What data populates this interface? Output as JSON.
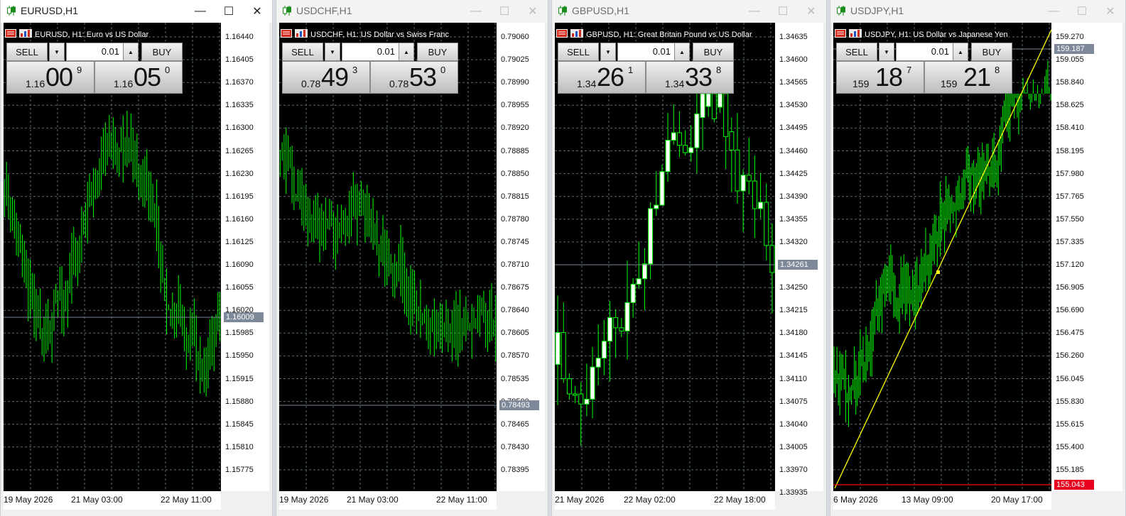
{
  "windows": [
    {
      "id": "eurusd",
      "title": "EURUSD,H1",
      "chart_label": "EURUSD, H1:  Euro vs US Dollar",
      "sell_label": "SELL",
      "buy_label": "BUY",
      "lot": "0.01",
      "sell_prefix": "1.16",
      "sell_big": "00",
      "sell_sup": "9",
      "buy_prefix": "1.16",
      "buy_big": "05",
      "buy_sup": "0",
      "current_price": "1.16009",
      "x_labels": [
        "19 May 2026",
        "21 May 03:00",
        "22 May 11:00"
      ],
      "y_labels": [
        "1.16440",
        "1.16405",
        "1.16370",
        "1.16335",
        "1.16300",
        "1.16265",
        "1.16230",
        "1.16195",
        "1.16160",
        "1.16125",
        "1.16090",
        "1.16055",
        "1.16020",
        "1.15985",
        "1.15950",
        "1.15915",
        "1.15880",
        "1.15845",
        "1.15810",
        "1.15775"
      ]
    },
    {
      "id": "usdchf",
      "title": "USDCHF,H1",
      "chart_label": "USDCHF, H1:  US Dollar vs Swiss Franc",
      "sell_label": "SELL",
      "buy_label": "BUY",
      "lot": "0.01",
      "sell_prefix": "0.78",
      "sell_big": "49",
      "sell_sup": "3",
      "buy_prefix": "0.78",
      "buy_big": "53",
      "buy_sup": "0",
      "current_price": "0.78493",
      "x_labels": [
        "19 May 2026",
        "21 May 03:00",
        "22 May 11:00"
      ],
      "y_labels": [
        "0.79060",
        "0.79025",
        "0.78990",
        "0.78955",
        "0.78920",
        "0.78885",
        "0.78850",
        "0.78815",
        "0.78780",
        "0.78745",
        "0.78710",
        "0.78675",
        "0.78640",
        "0.78605",
        "0.78570",
        "0.78535",
        "0.78500",
        "0.78465",
        "0.78430",
        "0.78395"
      ]
    },
    {
      "id": "gbpusd",
      "title": "GBPUSD,H1",
      "chart_label": "GBPUSD, H1:  Great Britain Pound vs US Dollar",
      "sell_label": "SELL",
      "buy_label": "BUY",
      "lot": "0.01",
      "sell_prefix": "1.34",
      "sell_big": "26",
      "sell_sup": "1",
      "buy_prefix": "1.34",
      "buy_big": "33",
      "buy_sup": "8",
      "current_price": "1.34261",
      "x_labels": [
        "21 May 2026",
        "22 May 02:00",
        "22 May 18:00"
      ],
      "y_labels": [
        "1.34635",
        "1.34600",
        "1.34565",
        "1.34530",
        "1.34495",
        "1.34460",
        "1.34425",
        "1.34390",
        "1.34355",
        "1.34320",
        "1.34285",
        "1.34250",
        "1.34215",
        "1.34180",
        "1.34145",
        "1.34110",
        "1.34075",
        "1.34040",
        "1.34005",
        "1.33970",
        "1.33935"
      ]
    },
    {
      "id": "usdjpy",
      "title": "USDJPY,H1",
      "chart_label": "USDJPY, H1:  US Dollar vs Japanese Yen",
      "sell_label": "SELL",
      "buy_label": "BUY",
      "lot": "0.01",
      "sell_prefix": "159",
      "sell_big": "18",
      "sell_sup": "7",
      "buy_prefix": "159",
      "buy_big": "21",
      "buy_sup": "8",
      "current_price": "159.187",
      "level_price": "155.043",
      "x_labels": [
        "6 May 2026",
        "13 May 09:00",
        "20 May 17:00"
      ],
      "y_labels": [
        "159.270",
        "159.055",
        "158.840",
        "158.625",
        "158.410",
        "158.195",
        "157.980",
        "157.765",
        "157.550",
        "157.335",
        "157.120",
        "156.905",
        "156.690",
        "156.475",
        "156.260",
        "156.045",
        "155.830",
        "155.615",
        "155.400",
        "155.185"
      ]
    }
  ],
  "colors": {
    "candle": "#00ff00",
    "background": "#000000",
    "grid": "#5a6a6a",
    "bid_line": "#7d8899",
    "trendline": "#ffff00",
    "level_line": "#ff0000"
  },
  "icons": {
    "title_icon": "candlestick-chart-icon",
    "chart_icons": [
      "flag-icon",
      "one-click-trading-icon"
    ]
  }
}
